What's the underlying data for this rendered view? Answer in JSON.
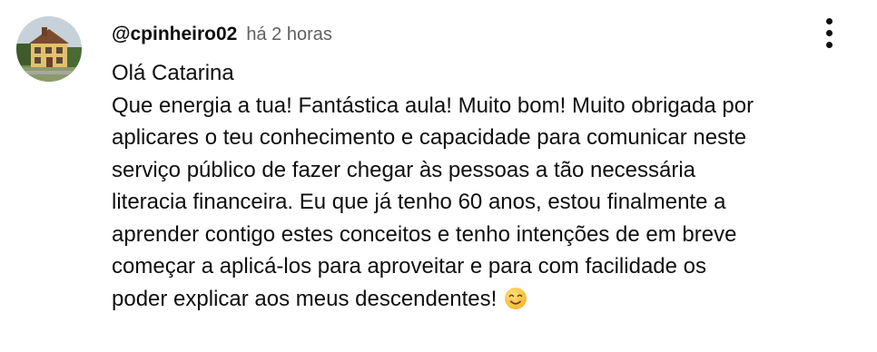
{
  "comment": {
    "author": "@cpinheiro02",
    "timestamp": "há 2 horas",
    "greeting": "Olá Catarina",
    "text": "Que energia a tua! Fantástica aula! Muito bom! Muito obrigada por\naplicares o teu conhecimento e capacidade para comunicar neste\nserviço público de fazer chegar às pessoas a tão necessária\nliteracia financeira. Eu que já tenho 60 anos, estou finalmente a\naprender contigo estes conceitos e tenho intenções de em breve\ncomeçar a aplicá-los para aproveitar e para com facilidade os\npoder explicar aos meus descendentes!",
    "emoji_icon": "smiling-face-emoji",
    "avatar_icon": "house-photo-avatar"
  },
  "menu": {
    "icon": "more-vertical-icon"
  },
  "colors": {
    "text": "#0f0f0f",
    "secondary_text": "#606060",
    "background": "#ffffff"
  }
}
